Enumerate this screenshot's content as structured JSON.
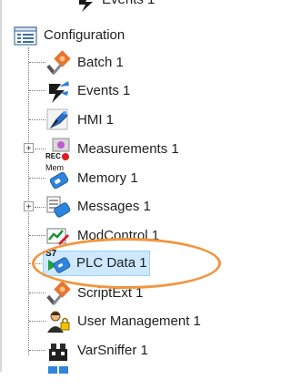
{
  "tree": {
    "top_partial_label": "Events 1",
    "root": {
      "label": "Configuration",
      "children": [
        {
          "label": "Batch 1",
          "icon": "batch-icon",
          "expandable": false
        },
        {
          "label": "Events 1",
          "icon": "events-icon",
          "expandable": false
        },
        {
          "label": "HMI 1",
          "icon": "hmi-icon",
          "expandable": false
        },
        {
          "label": "Measurements 1",
          "icon": "measurements-icon",
          "expandable": true,
          "icon_text": "REC"
        },
        {
          "label": "Memory 1",
          "icon": "memory-icon",
          "expandable": false,
          "icon_text": "Mem"
        },
        {
          "label": "Messages 1",
          "icon": "messages-icon",
          "expandable": true
        },
        {
          "label": "ModControl 1",
          "icon": "modcontrol-icon",
          "expandable": false
        },
        {
          "label": "PLC Data 1",
          "icon": "plc-data-icon",
          "expandable": false,
          "selected": true,
          "icon_text": "S7"
        },
        {
          "label": "ScriptExt 1",
          "icon": "scriptext-icon",
          "expandable": false
        },
        {
          "label": "User Management 1",
          "icon": "user-management-icon",
          "expandable": false
        },
        {
          "label": "VarSniffer 1",
          "icon": "varsniffer-icon",
          "expandable": false
        }
      ]
    },
    "expander_symbol": "+"
  },
  "colors": {
    "selection": "#cde8ff",
    "highlight": "#f09640"
  }
}
